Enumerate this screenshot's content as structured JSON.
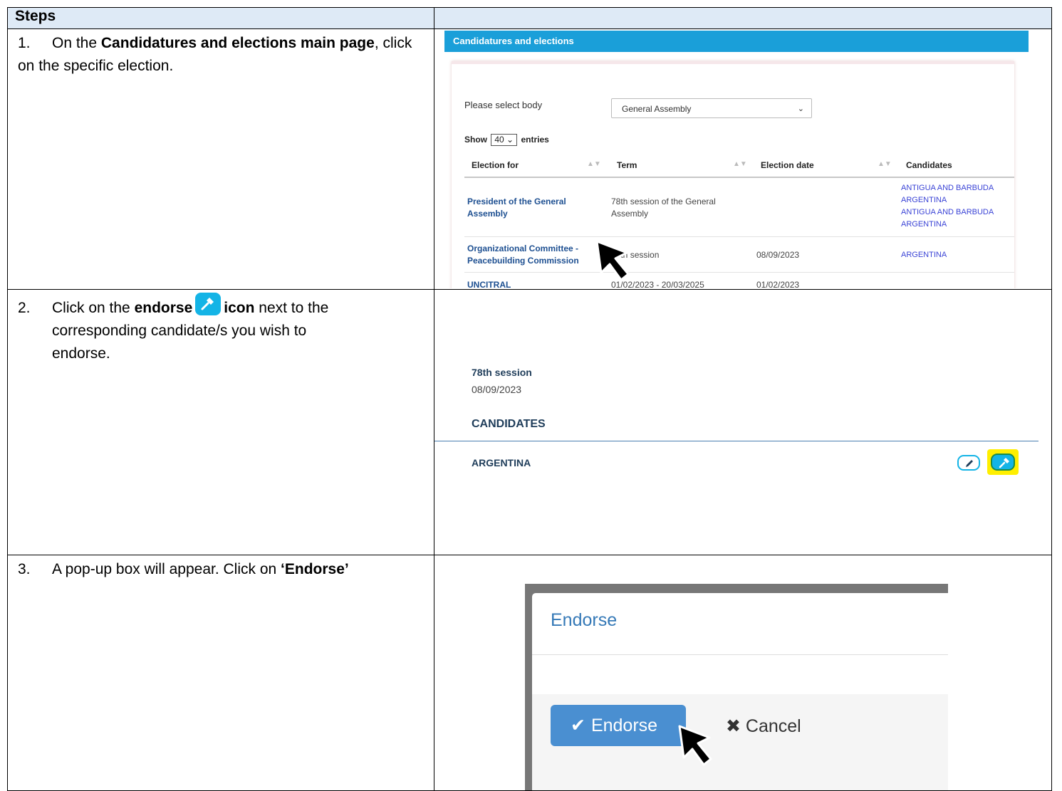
{
  "header": {
    "col1": "Steps",
    "col2": ""
  },
  "steps": [
    {
      "num": "1.",
      "text_a": "On the ",
      "bold_a": "Candidatures and elections main page",
      "text_b": ", click on the specific election."
    },
    {
      "num": "2.",
      "text_a": "Click on the ",
      "bold_a": "endorse",
      "bold_b": "icon",
      "text_b": " next to the",
      "line2": "corresponding candidate/s you wish to",
      "line3": "endorse."
    },
    {
      "num": "3.",
      "text_a": "A pop-up box will appear. Click on ",
      "bold_a": "‘Endorse’"
    }
  ],
  "shot1": {
    "bar_title": "Candidatures and elections",
    "select_label": "Please select body",
    "select_value": "General Assembly",
    "show_label": "Show",
    "show_value": "40",
    "entries_label": "entries",
    "columns": [
      "Election for",
      "Term",
      "Election date",
      "Candidates"
    ],
    "rows": [
      {
        "election": "President of the General Assembly",
        "term": "78th session of the General Assembly",
        "date": "",
        "candidates": [
          "ANTIGUA AND BARBUDA",
          "ARGENTINA",
          "ANTIGUA AND BARBUDA",
          "ARGENTINA"
        ]
      },
      {
        "election": "Organizational Committee - Peacebuilding Commission",
        "term": "78th session",
        "date": "08/09/2023",
        "candidates": [
          "ARGENTINA"
        ]
      },
      {
        "election": "UNCITRAL",
        "term": "01/02/2023 - 20/03/2025",
        "date": "01/02/2023",
        "candidates": []
      }
    ]
  },
  "shot2": {
    "term": "78th session",
    "date": "08/09/2023",
    "candidates_heading": "CANDIDATES",
    "candidate": "ARGENTINA"
  },
  "shot3": {
    "title": "Endorse",
    "endorse_label": "Endorse",
    "cancel_label": "Cancel"
  },
  "colors": {
    "accent": "#14b4e6",
    "bar": "#1a9fd9",
    "header_bg": "#deeaf6",
    "highlight": "#ffef00",
    "modal_btn": "#4a8fd1"
  }
}
